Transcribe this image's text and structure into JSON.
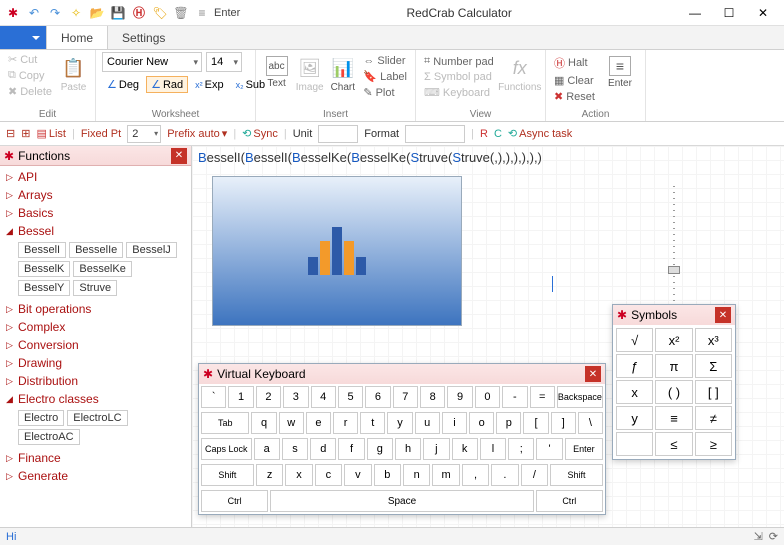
{
  "app_title": "RedCrab Calculator",
  "qat": {
    "enter_label": "Enter"
  },
  "window_controls": {
    "min": "—",
    "max": "☐",
    "close": "✕"
  },
  "tabs": {
    "file": "",
    "home": "Home",
    "settings": "Settings"
  },
  "ribbon": {
    "edit": {
      "cut": "Cut",
      "copy": "Copy",
      "delete": "Delete",
      "paste": "Paste",
      "label": "Edit"
    },
    "worksheet": {
      "font": "Courier New",
      "size": "14",
      "deg": "Deg",
      "rad": "Rad",
      "exp": "Exp",
      "sub": "Sub",
      "label": "Worksheet"
    },
    "insert": {
      "text": "Text",
      "image": "Image",
      "chart": "Chart",
      "slider": "Slider",
      "label_btn": "Label",
      "plot": "Plot",
      "label": "Insert"
    },
    "view": {
      "numberpad": "Number pad",
      "symbolpad": "Symbol pad",
      "keyboard": "Keyboard",
      "functions": "Functions",
      "label": "View"
    },
    "action": {
      "halt": "Halt",
      "clear": "Clear",
      "reset": "Reset",
      "enter": "Enter",
      "label": "Action"
    }
  },
  "optbar": {
    "list": "List",
    "fixed": "Fixed Pt",
    "fixed_val": "2",
    "prefix": "Prefix auto",
    "sync": "Sync",
    "unit": "Unit",
    "format": "Format",
    "async": "Async task"
  },
  "sidebar": {
    "title": "Functions",
    "items": [
      {
        "label": "API"
      },
      {
        "label": "Arrays"
      },
      {
        "label": "Basics"
      },
      {
        "label": "Bessel",
        "expanded": true,
        "leaves": [
          "BesselI",
          "BesselIe",
          "BesselJ",
          "BesselK",
          "BesselKe",
          "BesselY",
          "Struve"
        ]
      },
      {
        "label": "Bit operations"
      },
      {
        "label": "Complex"
      },
      {
        "label": "Conversion"
      },
      {
        "label": "Drawing"
      },
      {
        "label": "Distribution"
      },
      {
        "label": "Electro classes",
        "expanded": true,
        "leaves": [
          "Electro",
          "ElectroLC",
          "ElectroAC"
        ]
      },
      {
        "label": "Finance"
      },
      {
        "label": "Generate"
      }
    ]
  },
  "formula_parts": [
    "B",
    "esselI(",
    "B",
    "esselI(",
    "B",
    "esselKe(",
    "B",
    "esselKe(",
    "S",
    "truve(",
    "S",
    "truve(,),),),),),)"
  ],
  "vk": {
    "title": "Virtual Keyboard",
    "row1": [
      "`",
      "1",
      "2",
      "3",
      "4",
      "5",
      "6",
      "7",
      "8",
      "9",
      "0",
      "-",
      "=",
      "Backspace"
    ],
    "row2": [
      "Tab",
      "q",
      "w",
      "e",
      "r",
      "t",
      "y",
      "u",
      "i",
      "o",
      "p",
      "[",
      "]",
      "\\"
    ],
    "row3": [
      "Caps Lock",
      "a",
      "s",
      "d",
      "f",
      "g",
      "h",
      "j",
      "k",
      "l",
      ";",
      "'",
      "Enter"
    ],
    "row4": [
      "Shift",
      "z",
      "x",
      "c",
      "v",
      "b",
      "n",
      "m",
      ",",
      ".",
      "/",
      "Shift"
    ],
    "row5": [
      "Ctrl",
      "Space",
      "Ctrl"
    ]
  },
  "symbols": {
    "title": "Symbols",
    "cells": [
      "√",
      "x²",
      "x³",
      "ƒ",
      "π",
      "Σ",
      "x",
      "( )",
      "[ ]",
      "y",
      "≡",
      "≠",
      "",
      "≤",
      "≥"
    ]
  },
  "status": {
    "left": "Hi"
  }
}
